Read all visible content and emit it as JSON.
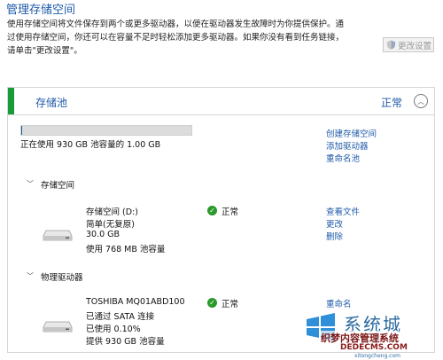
{
  "header": {
    "title": "管理存储空间",
    "desc_line1": "使用存储空间将文件保存到两个或更多驱动器，以便在驱动器发生故障时为你提供保护。通",
    "desc_line2": "过使用存储空间，你还可以在容量不足时轻松添加更多驱动器。如果你没有看到任务链接，",
    "desc_line3": "请单击\"更改设置\"。",
    "change_settings": "更改设置"
  },
  "pool": {
    "title": "存储池",
    "status": "正常",
    "usage_text": "正在使用 930 GB 池容量的 1.00 GB",
    "usage_fraction": 0.001,
    "links": [
      "创建存储空间",
      "添加驱动器",
      "重命名池"
    ]
  },
  "spaces_section": {
    "title": "存储空间",
    "item": {
      "name": "存储空间 (D:)",
      "resiliency": "简单(无复原)",
      "size": "30.0 GB",
      "usage": "使用 768 MB 池容量",
      "status": "正常",
      "links": [
        "查看文件",
        "更改",
        "删除"
      ]
    }
  },
  "drives_section": {
    "title": "物理驱动器",
    "item": {
      "name": "TOSHIBA MQ01ABD100",
      "connection": "已通过 SATA 连接",
      "used": "已使用 0.10%",
      "provides": "提供 930 GB 池容量",
      "status": "正常",
      "links": [
        "重命名"
      ]
    }
  },
  "watermark": {
    "brand": "系统城",
    "line1": "织梦内容管理系统",
    "line2": "DEDECMS.COM",
    "line3": "xitongcheng.com"
  },
  "colors": {
    "accent": "#1e5aa8",
    "ok_green": "#1a9a3a"
  }
}
